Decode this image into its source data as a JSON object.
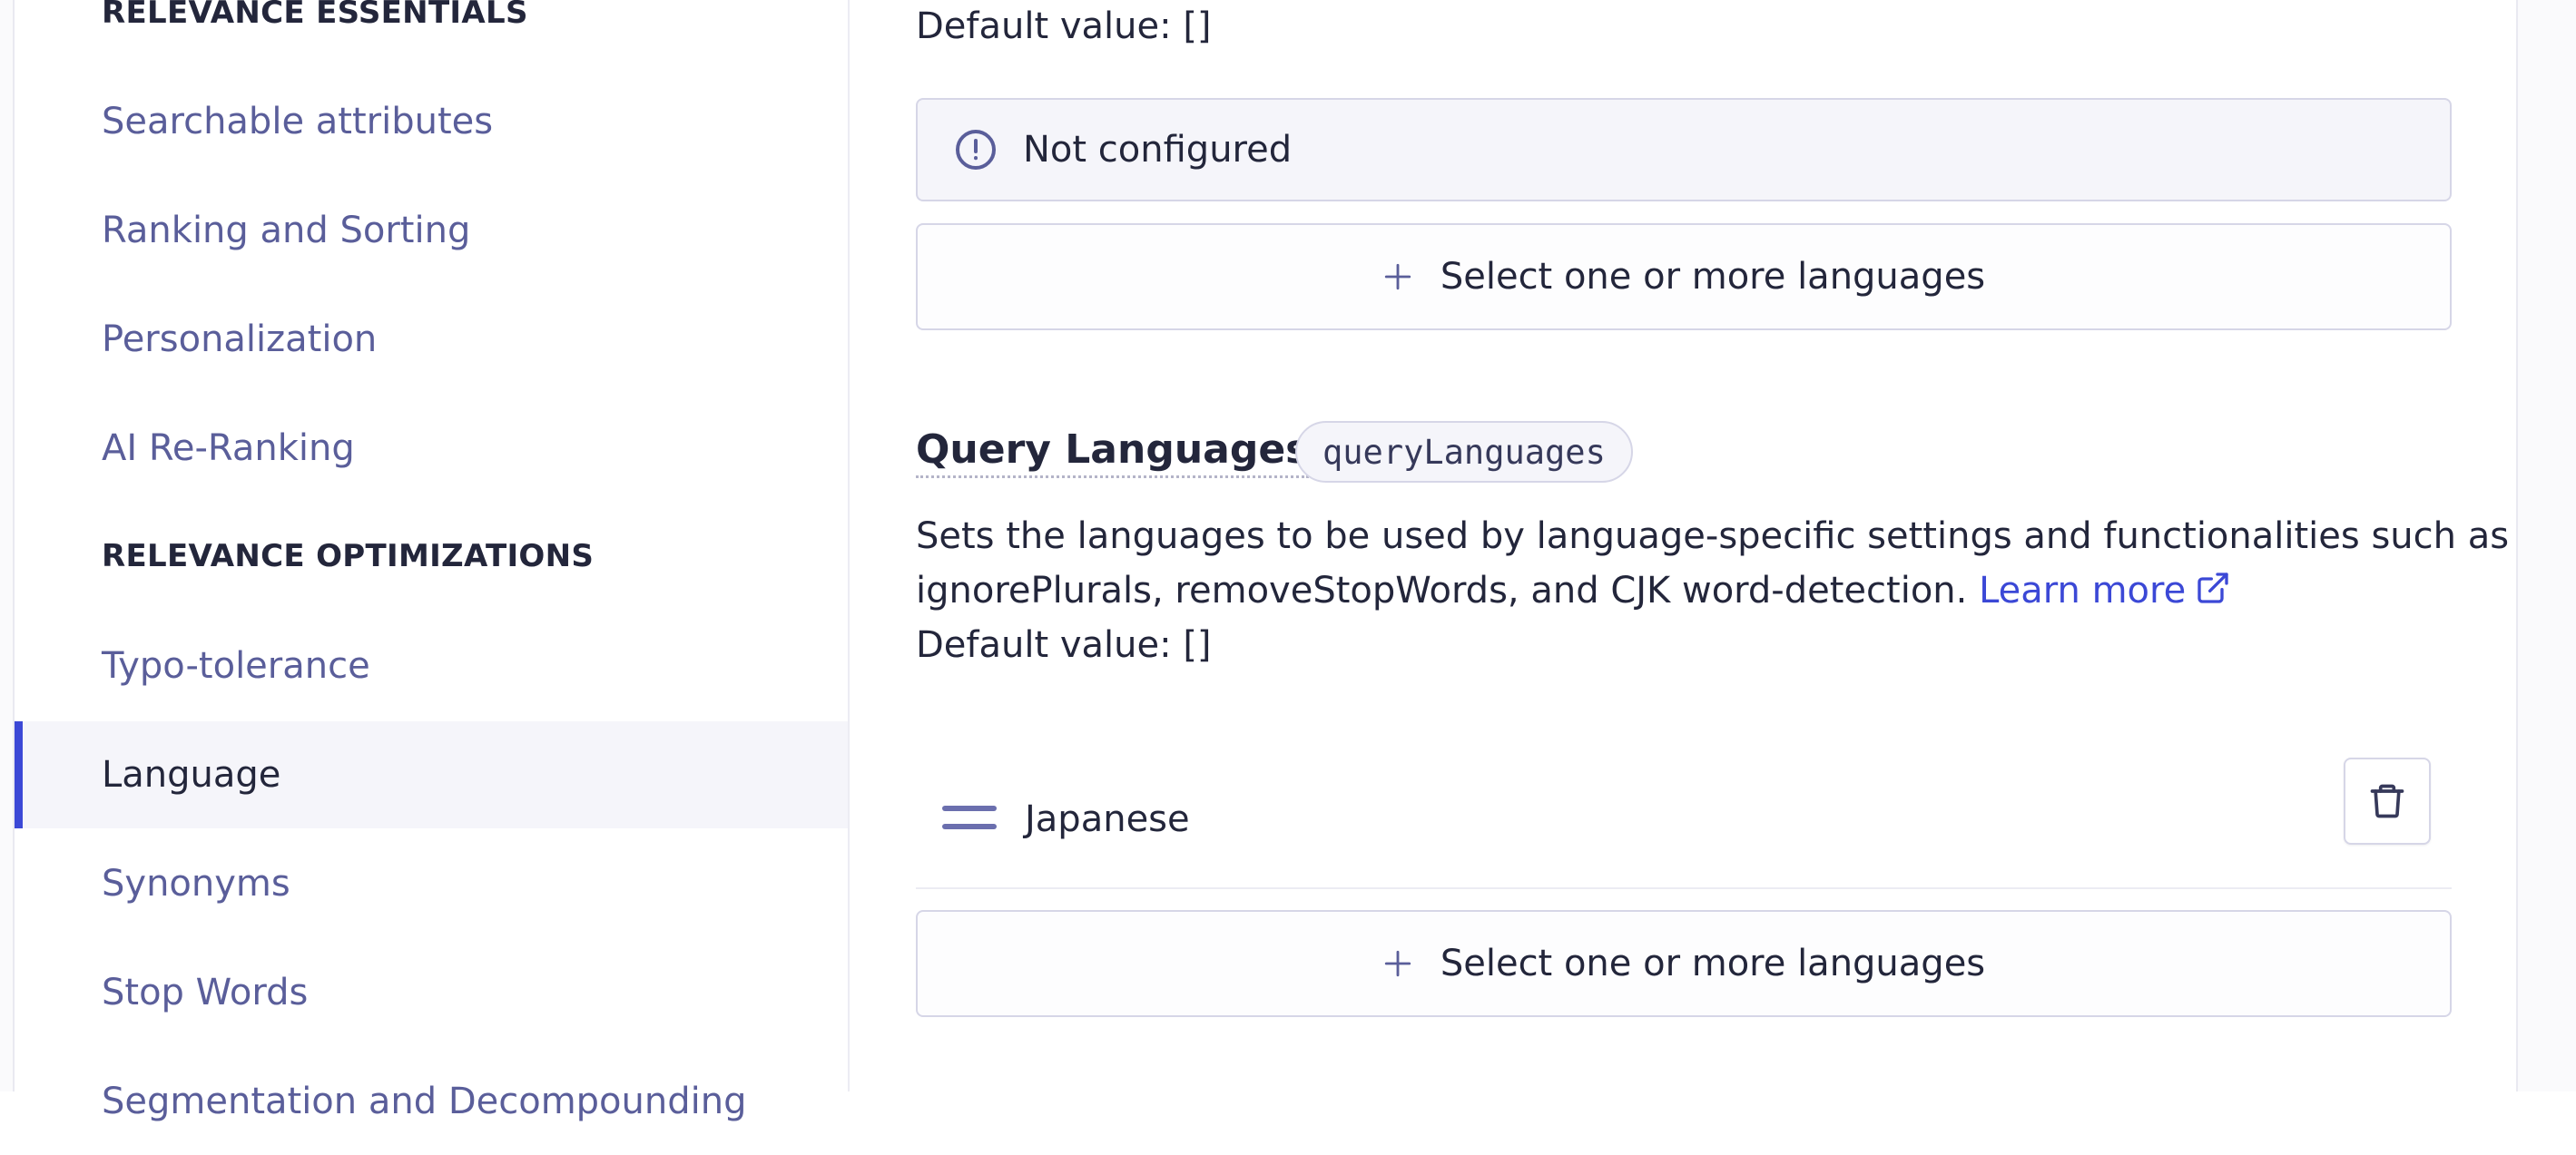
{
  "sidebar": {
    "sections": [
      {
        "title": "RELEVANCE ESSENTIALS"
      },
      {
        "title": "RELEVANCE OPTIMIZATIONS"
      }
    ],
    "items": [
      {
        "label": "Searchable attributes"
      },
      {
        "label": "Ranking and Sorting"
      },
      {
        "label": "Personalization"
      },
      {
        "label": "AI Re-Ranking"
      },
      {
        "label": "Typo-tolerance"
      },
      {
        "label": "Language",
        "active": true
      },
      {
        "label": "Synonyms"
      },
      {
        "label": "Stop Words"
      },
      {
        "label": "Segmentation and Decompounding"
      }
    ]
  },
  "main": {
    "prev_setting": {
      "default_value": "Default value: []",
      "status": "Not configured",
      "status_icon": "info-circle-icon",
      "add_label": "Select one or more languages"
    },
    "query_languages": {
      "title": "Query Languages",
      "code": "queryLanguages",
      "description_line1": "Sets the languages to be used by language-specific settings and functionalities such as",
      "description_line2": "ignorePlurals, removeStopWords, and CJK word-detection.",
      "learn_more": "Learn more",
      "default_value": "Default value: []",
      "languages": [
        "Japanese"
      ],
      "add_label": "Select one or more languages"
    }
  },
  "colors": {
    "accent": "#3b48d6",
    "sidebar_link": "#5a5e9a",
    "text": "#23263b",
    "border": "#d6d6e7"
  }
}
